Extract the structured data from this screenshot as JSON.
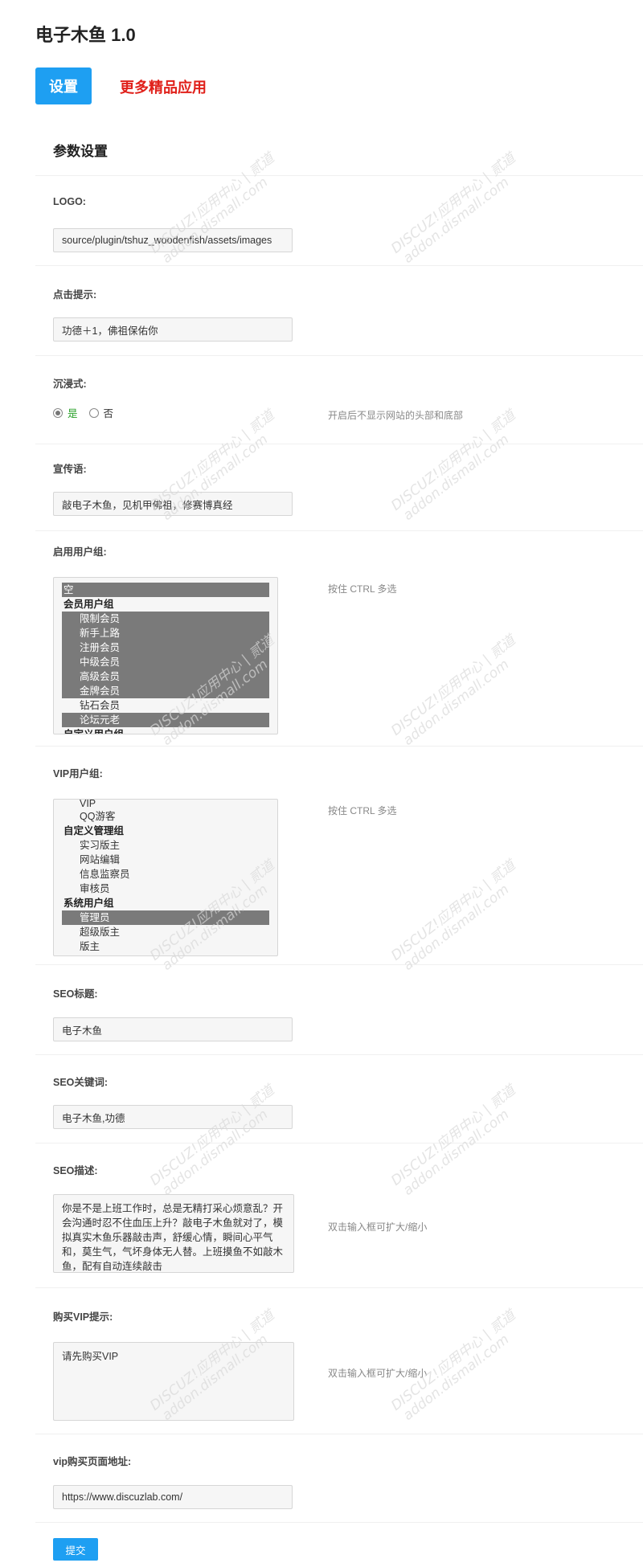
{
  "app": {
    "title": "电子木鱼 1.0",
    "settings_button": "设置",
    "more_apps_link": "更多精品应用"
  },
  "panel": {
    "title": "参数设置"
  },
  "fields": {
    "logo": {
      "label": "LOGO:",
      "value": "source/plugin/tshuz_woodenfish/assets/images"
    },
    "click_tip": {
      "label": "点击提示:",
      "value": "功德＋1，佛祖保佑你"
    },
    "immersive": {
      "label": "沉浸式:",
      "option_yes": "是",
      "option_no": "否",
      "selected": "是",
      "hint": "开启后不显示网站的头部和底部"
    },
    "slogan": {
      "label": "宣传语:",
      "value": "敲电子木鱼，见机甲佛祖，修赛博真经"
    },
    "enabled_groups": {
      "label": "启用用户组:",
      "hint": "按住 CTRL 多选",
      "options": [
        {
          "label": "空",
          "type": "option",
          "selected": true
        },
        {
          "label": "会员用户组",
          "type": "group",
          "selected": false
        },
        {
          "label": "限制会员",
          "type": "option",
          "selected": true
        },
        {
          "label": "新手上路",
          "type": "option",
          "selected": true
        },
        {
          "label": "注册会员",
          "type": "option",
          "selected": true
        },
        {
          "label": "中级会员",
          "type": "option",
          "selected": true
        },
        {
          "label": "高级会员",
          "type": "option",
          "selected": true
        },
        {
          "label": "金牌会员",
          "type": "option",
          "selected": true
        },
        {
          "label": "钻石会员",
          "type": "option",
          "selected": false
        },
        {
          "label": "论坛元老",
          "type": "option",
          "selected": true
        },
        {
          "label": "自定义用户组",
          "type": "group",
          "selected": false
        }
      ]
    },
    "vip_groups": {
      "label": "VIP用户组:",
      "hint": "按住 CTRL 多选",
      "options": [
        {
          "label": "VIP",
          "type": "option",
          "selected": false
        },
        {
          "label": "QQ游客",
          "type": "option",
          "selected": false
        },
        {
          "label": "自定义管理组",
          "type": "group",
          "selected": false
        },
        {
          "label": "实习版主",
          "type": "option",
          "selected": false
        },
        {
          "label": "网站编辑",
          "type": "option",
          "selected": false
        },
        {
          "label": "信息监察员",
          "type": "option",
          "selected": false
        },
        {
          "label": "审核员",
          "type": "option",
          "selected": false
        },
        {
          "label": "系统用户组",
          "type": "group",
          "selected": false
        },
        {
          "label": "管理员",
          "type": "option",
          "selected": true
        },
        {
          "label": "超级版主",
          "type": "option",
          "selected": false
        },
        {
          "label": "版主",
          "type": "option",
          "selected": false
        }
      ]
    },
    "seo_title": {
      "label": "SEO标题:",
      "value": "电子木鱼"
    },
    "seo_keywords": {
      "label": "SEO关键词:",
      "value": "电子木鱼,功德"
    },
    "seo_description": {
      "label": "SEO描述:",
      "value": "你是不是上班工作时，总是无精打采心烦意乱？开会沟通时忍不住血压上升？敲电子木鱼就对了，模拟真实木鱼乐器敲击声，舒缓心情，瞬间心平气和，莫生气，气坏身体无人替。上班摸鱼不如敲木鱼，配有自动连续敲击",
      "hint": "双击输入框可扩大/缩小"
    },
    "buy_vip_tip": {
      "label": "购买VIP提示:",
      "value": "请先购买VIP",
      "hint": "双击输入框可扩大/缩小"
    },
    "vip_url": {
      "label": "vip购买页面地址:",
      "value": "https://www.discuzlab.com/"
    }
  },
  "submit_label": "提交",
  "watermark": {
    "line1": "DISCUZ!应用中心 | 贰道",
    "line2": "addon.dismall.com"
  }
}
